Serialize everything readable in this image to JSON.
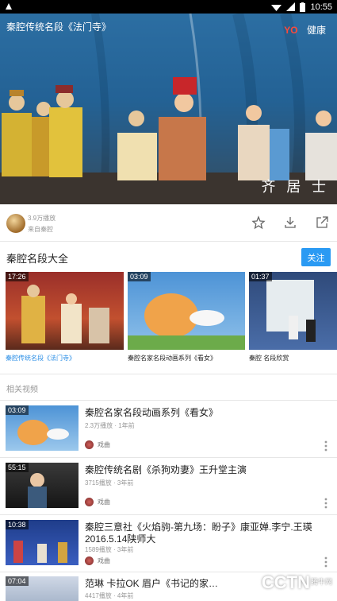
{
  "status_bar": {
    "time": "10:55"
  },
  "player": {
    "title": "秦腔传统名段《法门寺》",
    "logo_text": "YO",
    "logo_suffix": "健康",
    "watermark": "齐 居 士"
  },
  "video_meta": {
    "play_count": "3.9万播放",
    "source": "来自秦腔"
  },
  "album": {
    "title": "秦腔名段大全",
    "follow_label": "关注",
    "items": [
      {
        "duration": "17:26",
        "title": "秦腔传统名段《法门寺》",
        "active": true
      },
      {
        "duration": "03:09",
        "title": "秦腔名家名段动画系列《看女》",
        "active": false
      },
      {
        "duration": "01:37",
        "title": "秦腔 名段欣赏",
        "active": false
      }
    ]
  },
  "related": {
    "header": "相关视频",
    "items": [
      {
        "duration": "03:09",
        "title": "秦腔名家名段动画系列《看女》",
        "meta": "2.3万播放 · 1年前",
        "channel": "戏曲"
      },
      {
        "duration": "55:15",
        "title": "秦腔传统名剧《杀狗劝妻》王升堂主演",
        "meta": "3715播放 · 3年前",
        "channel": "戏曲"
      },
      {
        "duration": "10:38",
        "title": "秦腔三意社《火焰驹-第九场：盼子》康亚婵.李宁.王瑛 2016.5.14陕师大",
        "meta": "1589播放 · 3年前",
        "channel": "戏曲"
      },
      {
        "duration": "07:04",
        "title": "范琳 卡拉OK 眉户《书记的家…",
        "meta": "4417播放 · 4年前",
        "channel": ""
      }
    ]
  },
  "overlay": {
    "brand": "CCTN",
    "site": "腾牛网"
  }
}
